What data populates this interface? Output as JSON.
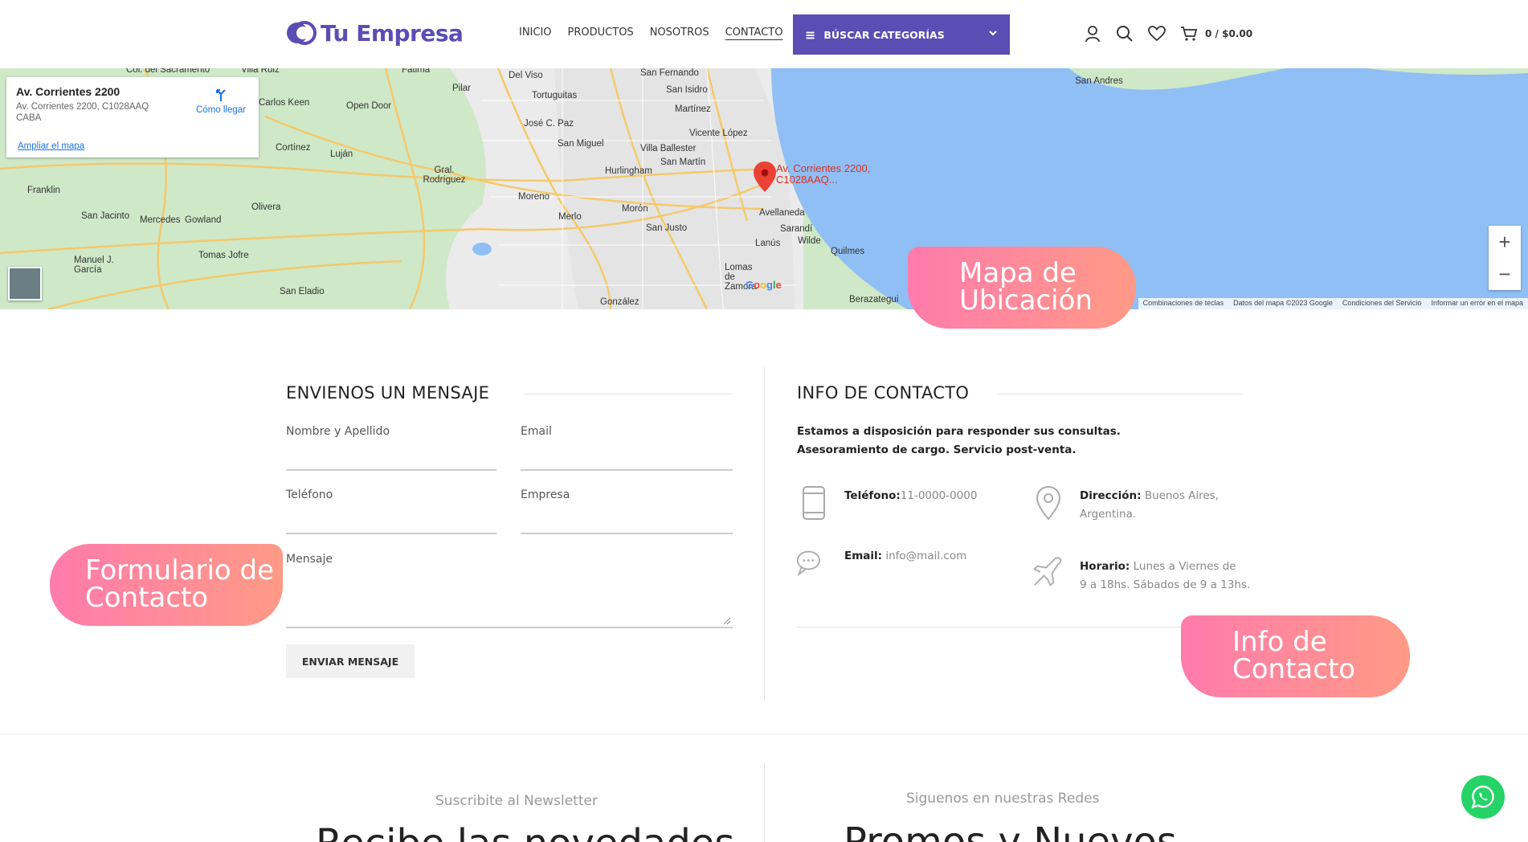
{
  "header": {
    "logo_text": "Tu Empresa",
    "nav": [
      "INICIO",
      "PRODUCTOS",
      "NOSOTROS",
      "CONTACTO"
    ],
    "active_nav": "CONTACTO",
    "categories_button": "BÚSCAR CATEGORÍAS",
    "cart_total": "0 / $0.00",
    "brand_color": "#5b4db3"
  },
  "map": {
    "card": {
      "title": "Av. Corrientes 2200",
      "address": "Av. Corrientes 2200, C1028AAQ CABA",
      "enlarge": "Ampliar el mapa",
      "directions": "Cómo llegar"
    },
    "pin_label": "Av. Corrientes 2200, C1028AAQ...",
    "places": [
      "San Fernando",
      "Del Viso",
      "Tortuguitas",
      "San Isidro",
      "Martínez",
      "Pilar",
      "Carlos Keen",
      "Open Door",
      "José C. Paz",
      "San Miguel",
      "Vicente López",
      "Villa Ballester",
      "Hurlingham",
      "San Martín",
      "Cortínez",
      "Luján",
      "Gral. Rodríguez",
      "Moreno",
      "Merlo",
      "Morón",
      "Avellaneda",
      "Sarandí",
      "Wilde",
      "Lanús",
      "Quilmes",
      "San Justo",
      "Lomas de Zamora",
      "González",
      "Berazategui",
      "Franklin",
      "San Jacinto",
      "Mercedes",
      "Gowland",
      "Olivera",
      "Manuel J. García",
      "Tomas Jofre",
      "San Eladio",
      "San Andres",
      "Col. del Sacramento",
      "Villa Ruiz",
      "Fátima"
    ],
    "footer": [
      "Combinaciones de teclas",
      "Datos del mapa ©2023 Google",
      "Condiciones del Servicio",
      "Informar un error en el mapa"
    ],
    "google": "Google"
  },
  "annotations": {
    "map": "Mapa de Ubicación",
    "form": "Formulario de Contacto",
    "info": "Info de Contacto"
  },
  "form": {
    "title": "ENVIENOS UN MENSAJE",
    "name_label": "Nombre y Apellido",
    "email_label": "Email",
    "phone_label": "Teléfono",
    "company_label": "Empresa",
    "message_label": "Mensaje",
    "submit": "ENVIAR MENSAJE"
  },
  "info": {
    "title": "INFO DE CONTACTO",
    "intro_1": "Estamos a disposición para responder sus consultas.",
    "intro_2": "Asesoramiento de cargo. Servicio post-venta.",
    "phone_label": "Teléfono:",
    "phone_value": "11-0000-0000",
    "address_label": "Dirección:",
    "address_value_1": "Buenos Aires,",
    "address_value_2": "Argentina.",
    "email_label": "Email:",
    "email_value": "info@mail.com",
    "hours_label": "Horario:",
    "hours_value_1": "Lunes a Viernes de",
    "hours_value_2": "9 a 18hs. Sábados de 9 a 13hs."
  },
  "newsletter": {
    "subtitle": "Suscribite al Newsletter",
    "heading": "Recibe las novedades"
  },
  "social": {
    "subtitle": "Siguenos en nuestras Redes",
    "heading": "Promos y Nuevos"
  }
}
